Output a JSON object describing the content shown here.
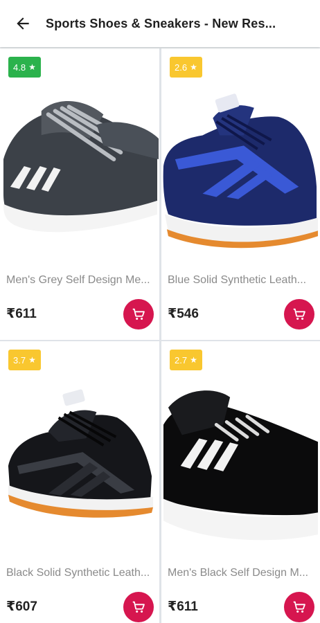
{
  "header": {
    "title": "Sports Shoes & Sneakers - New Res..."
  },
  "colors": {
    "rating_high": "#2bb24c",
    "rating_mid": "#f9c72f",
    "cart_accent": "#d6164f"
  },
  "products": [
    {
      "rating": "4.8",
      "name": "Men's Grey Self Design Me...",
      "price": "₹611",
      "image": "grey-sneaker"
    },
    {
      "rating": "2.6",
      "name": "Blue Solid Synthetic Leath...",
      "price": "₹546",
      "image": "blue-sneaker"
    },
    {
      "rating": "3.7",
      "name": "Black Solid Synthetic Leath...",
      "price": "₹607",
      "image": "black-sneaker-orange-sole"
    },
    {
      "rating": "2.7",
      "name": "Men's Black Self Design M...",
      "price": "₹611",
      "image": "black-sneaker-white-stripes"
    }
  ]
}
